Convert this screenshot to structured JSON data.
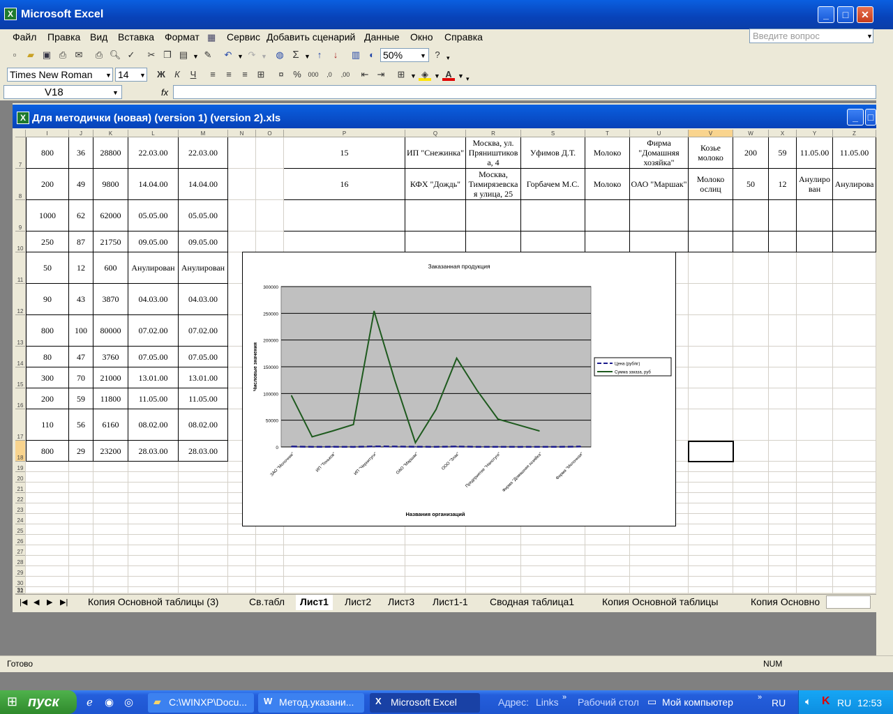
{
  "app": {
    "title": "Microsoft Excel"
  },
  "menu": [
    "Файл",
    "Правка",
    "Вид",
    "Вставка",
    "Формат",
    "Сервис",
    "Добавить сценарий",
    "Данные",
    "Окно",
    "Справка"
  ],
  "help_placeholder": "Введите вопрос",
  "toolbar": {
    "zoom": "50%",
    "font_name": "Times New Roman",
    "font_size": "14"
  },
  "formula": {
    "name_box": "V18",
    "fx": "fx"
  },
  "workbook": {
    "title": "Для методички (новая) (version 1) (version 2).xls"
  },
  "columns": [
    "I",
    "J",
    "K",
    "L",
    "M",
    "N",
    "O",
    "P",
    "Q",
    "R",
    "S",
    "T",
    "U",
    "V",
    "W",
    "X",
    "Y",
    "Z"
  ],
  "rows": [
    {
      "num": "7",
      "I": "800",
      "J": "36",
      "K": "28800",
      "L": "22.03.00",
      "M": "22.03.00",
      "P": "15",
      "Q": "ИП \"Снежинка\"",
      "R": "Москва, ул. Пряништиков а, 4",
      "S": "Уфимов Д.Т.",
      "T": "Молоко",
      "U": "Фирма \"Домашняя хозяйка\"",
      "V": "Козье молоко",
      "W": "200",
      "X": "59",
      "Y": "11.05.00",
      "Z": "11.05.00"
    },
    {
      "num": "8",
      "I": "200",
      "J": "49",
      "K": "9800",
      "L": "14.04.00",
      "M": "14.04.00",
      "P": "16",
      "Q": "КФХ \"Дождь\"",
      "R": "Москва, Тимирязевска я улица, 25",
      "S": "Горбачем М.С.",
      "T": "Молоко",
      "U": "ОАО \"Маршак\"",
      "V": "Молоко ослиц",
      "W": "50",
      "X": "12",
      "Y": "Анулиро ван",
      "Z": "Анулирова"
    },
    {
      "num": "9",
      "I": "1000",
      "J": "62",
      "K": "62000",
      "L": "05.05.00",
      "M": "05.05.00"
    },
    {
      "num": "10",
      "I": "250",
      "J": "87",
      "K": "21750",
      "L": "09.05.00",
      "M": "09.05.00"
    },
    {
      "num": "11",
      "I": "50",
      "J": "12",
      "K": "600",
      "L": "Анулирован",
      "M": "Анулирован"
    },
    {
      "num": "12",
      "I": "90",
      "J": "43",
      "K": "3870",
      "L": "04.03.00",
      "M": "04.03.00"
    },
    {
      "num": "13",
      "I": "800",
      "J": "100",
      "K": "80000",
      "L": "07.02.00",
      "M": "07.02.00"
    },
    {
      "num": "14",
      "I": "80",
      "J": "47",
      "K": "3760",
      "L": "07.05.00",
      "M": "07.05.00"
    },
    {
      "num": "15",
      "I": "300",
      "J": "70",
      "K": "21000",
      "L": "13.01.00",
      "M": "13.01.00"
    },
    {
      "num": "16",
      "I": "200",
      "J": "59",
      "K": "11800",
      "L": "11.05.00",
      "M": "11.05.00"
    },
    {
      "num": "17",
      "I": "110",
      "J": "56",
      "K": "6160",
      "L": "08.02.00",
      "M": "08.02.00"
    },
    {
      "num": "18",
      "I": "800",
      "J": "29",
      "K": "23200",
      "L": "28.03.00",
      "M": "28.03.00"
    }
  ],
  "empty_rows": [
    "19",
    "20",
    "21",
    "22",
    "23",
    "24",
    "25",
    "26",
    "27",
    "28",
    "29",
    "30",
    "31",
    "32"
  ],
  "chart_data": {
    "type": "line",
    "title": "Заказанная продукция",
    "xlabel": "Названия организаций",
    "ylabel": "Числовые значения",
    "ylim": [
      0,
      300000
    ],
    "yticks": [
      "0",
      "50000",
      "100000",
      "150000",
      "200000",
      "250000",
      "300000"
    ],
    "categories": [
      "ЗАО \"Молочник\"",
      "",
      "ИП \"Теньков\"",
      "",
      "ИП \"Чернитуги\"",
      "",
      "ОАО \"Маршак\"",
      "",
      "ООО \"Злак\"",
      "",
      "Предприятие \"Нанотуги\"",
      "",
      "Фирма \"Домашняя хозяйка\"",
      "",
      "Фирма \"Молочная\""
    ],
    "series": [
      {
        "name": "Цена (руб/кг)",
        "color": "#1a1a8c",
        "values": [
          800,
          200,
          250,
          50,
          1000,
          800,
          300,
          200,
          800,
          110,
          200,
          80,
          200,
          90,
          800
        ]
      },
      {
        "name": "Сумма заказа, руб",
        "color": "#1e5a1e",
        "values": [
          96000,
          19000,
          30000,
          42000,
          254000,
          125000,
          8000,
          70000,
          166000,
          105000,
          52000,
          41000,
          30000
        ]
      }
    ],
    "legend_position": "right"
  },
  "sheet_tabs": [
    "Копия Основной таблицы (3)",
    "Св.табл",
    "Лист1",
    "Лист2",
    "Лист3",
    "Лист1-1",
    "Сводная таблица1",
    "Копия Основной таблицы",
    "Копия Основно"
  ],
  "active_tab": "Лист1",
  "status": {
    "left": "Готово",
    "num": "NUM"
  },
  "taskbar": {
    "start": "пуск",
    "tasks": [
      "C:\\WINXP\\Docu...",
      "Метод.указани...",
      "Microsoft Excel"
    ],
    "address": "Адрес:",
    "links": "Links",
    "desktop": "Рабочий стол",
    "mycomp": "Мой компьютер",
    "lang": "RU",
    "time": "12:53"
  }
}
